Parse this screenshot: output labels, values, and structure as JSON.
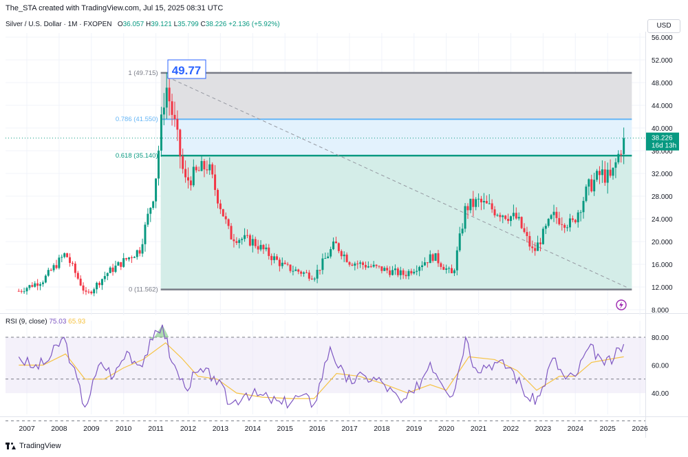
{
  "header": {
    "credit": "The_STA created with TradingView.com, Jul 15, 2025 08:31 UTC"
  },
  "symbol_bar": {
    "title": "Silver / U.S. Dollar · 1M · FXOPEN",
    "o_label": "O",
    "o_value": "36.057",
    "h_label": "H",
    "h_value": "39.121",
    "l_label": "L",
    "l_value": "35.799",
    "c_label": "C",
    "c_value": "38.226",
    "change": "+2.136 (+5.92%)"
  },
  "currency_button": "USD",
  "rsi_legend": {
    "name": "RSI (9, close)",
    "rsi_value": "75.03",
    "ma_value": "65.93"
  },
  "footer": {
    "brand": "TradingView"
  },
  "colors": {
    "up": "#089981",
    "down": "#f23645",
    "fib_top": "#e0e0e3",
    "fib_mid": "#e3f2fd",
    "fib_bottom": "#d4ede8",
    "rsi_line": "#7e57c2",
    "rsi_ma": "#f6c343",
    "line_0618": "#089981",
    "line_0786": "#64b5f6"
  },
  "chart_data": [
    {
      "type": "candlestick",
      "x_unit": "year",
      "x_ticks": [
        "2007",
        "2008",
        "2009",
        "2010",
        "2011",
        "2012",
        "2013",
        "2014",
        "2015",
        "2016",
        "2017",
        "2018",
        "2019",
        "2020",
        "2021",
        "2022",
        "2023",
        "2024",
        "2025",
        "2026"
      ],
      "y_ticks": [
        "8.000",
        "12.000",
        "16.000",
        "20.000",
        "24.000",
        "28.000",
        "32.000",
        "36.000",
        "40.000",
        "44.000",
        "48.000",
        "52.000",
        "56.000"
      ],
      "ylim": [
        8,
        57
      ],
      "scale": "linear",
      "grid": true,
      "last_price": {
        "value": "38.226",
        "countdown": "16d 13h"
      },
      "high_marker": "49.77",
      "fibonacci": [
        {
          "label": "1 (49.715)",
          "value": 49.715
        },
        {
          "label": "0.786 (41.550)",
          "value": 41.55
        },
        {
          "label": "0.618 (35.140)",
          "value": 35.14
        },
        {
          "label": "0 (11.562)",
          "value": 11.562
        }
      ],
      "fib_x_range": [
        2011.15,
        2025.75
      ],
      "trend_line": {
        "from": [
          2011.35,
          49.0
        ],
        "to": [
          2025.65,
          11.8
        ]
      },
      "key_points": [
        {
          "x": 2006.75,
          "y": 11.3
        },
        {
          "x": 2007.5,
          "y": 13.2
        },
        {
          "x": 2008.2,
          "y": 17.9
        },
        {
          "x": 2008.85,
          "y": 10.5
        },
        {
          "x": 2009.5,
          "y": 14.5
        },
        {
          "x": 2010.5,
          "y": 18.6
        },
        {
          "x": 2010.95,
          "y": 29.0
        },
        {
          "x": 2011.3,
          "y": 48.0
        },
        {
          "x": 2011.6,
          "y": 40.0
        },
        {
          "x": 2011.9,
          "y": 30.5
        },
        {
          "x": 2012.6,
          "y": 33.5
        },
        {
          "x": 2013.3,
          "y": 21.0
        },
        {
          "x": 2014.0,
          "y": 20.0
        },
        {
          "x": 2015.0,
          "y": 15.5
        },
        {
          "x": 2015.9,
          "y": 13.9
        },
        {
          "x": 2016.55,
          "y": 19.6
        },
        {
          "x": 2017.0,
          "y": 16.5
        },
        {
          "x": 2018.7,
          "y": 14.2
        },
        {
          "x": 2019.6,
          "y": 17.5
        },
        {
          "x": 2020.2,
          "y": 14.0
        },
        {
          "x": 2020.6,
          "y": 26.0
        },
        {
          "x": 2021.0,
          "y": 27.0
        },
        {
          "x": 2021.5,
          "y": 25.5
        },
        {
          "x": 2022.2,
          "y": 24.0
        },
        {
          "x": 2022.7,
          "y": 18.0
        },
        {
          "x": 2023.3,
          "y": 24.5
        },
        {
          "x": 2023.9,
          "y": 23.0
        },
        {
          "x": 2024.4,
          "y": 29.5
        },
        {
          "x": 2024.8,
          "y": 32.0
        },
        {
          "x": 2025.1,
          "y": 31.0
        },
        {
          "x": 2025.5,
          "y": 38.2
        }
      ]
    },
    {
      "type": "line",
      "title": "RSI (9, close)",
      "y_ticks": [
        "40.00",
        "60.00",
        "80.00"
      ],
      "ylim": [
        28,
        92
      ],
      "bands": [
        30,
        50,
        70
      ],
      "series": [
        {
          "name": "RSI",
          "points": [
            {
              "x": 2006.75,
              "y": 66
            },
            {
              "x": 2007.2,
              "y": 58
            },
            {
              "x": 2007.6,
              "y": 62
            },
            {
              "x": 2008.15,
              "y": 80
            },
            {
              "x": 2008.4,
              "y": 60
            },
            {
              "x": 2008.8,
              "y": 30
            },
            {
              "x": 2009.3,
              "y": 62
            },
            {
              "x": 2009.7,
              "y": 52
            },
            {
              "x": 2010.1,
              "y": 70
            },
            {
              "x": 2010.5,
              "y": 60
            },
            {
              "x": 2010.9,
              "y": 78
            },
            {
              "x": 2011.2,
              "y": 89
            },
            {
              "x": 2011.5,
              "y": 62
            },
            {
              "x": 2011.9,
              "y": 44
            },
            {
              "x": 2012.3,
              "y": 55
            },
            {
              "x": 2012.8,
              "y": 52
            },
            {
              "x": 2013.3,
              "y": 32
            },
            {
              "x": 2013.8,
              "y": 40
            },
            {
              "x": 2014.5,
              "y": 36
            },
            {
              "x": 2014.9,
              "y": 32
            },
            {
              "x": 2015.5,
              "y": 38
            },
            {
              "x": 2015.9,
              "y": 32
            },
            {
              "x": 2016.4,
              "y": 73
            },
            {
              "x": 2016.9,
              "y": 48
            },
            {
              "x": 2017.5,
              "y": 52
            },
            {
              "x": 2018.0,
              "y": 48
            },
            {
              "x": 2018.6,
              "y": 33
            },
            {
              "x": 2019.0,
              "y": 40
            },
            {
              "x": 2019.5,
              "y": 62
            },
            {
              "x": 2020.2,
              "y": 38
            },
            {
              "x": 2020.6,
              "y": 80
            },
            {
              "x": 2020.9,
              "y": 58
            },
            {
              "x": 2021.5,
              "y": 62
            },
            {
              "x": 2022.0,
              "y": 58
            },
            {
              "x": 2022.6,
              "y": 34
            },
            {
              "x": 2022.9,
              "y": 38
            },
            {
              "x": 2023.3,
              "y": 65
            },
            {
              "x": 2023.7,
              "y": 50
            },
            {
              "x": 2024.0,
              "y": 52
            },
            {
              "x": 2024.4,
              "y": 72
            },
            {
              "x": 2024.7,
              "y": 68
            },
            {
              "x": 2024.9,
              "y": 60
            },
            {
              "x": 2025.2,
              "y": 65
            },
            {
              "x": 2025.5,
              "y": 75
            }
          ]
        },
        {
          "name": "MA",
          "points": [
            {
              "x": 2006.75,
              "y": 60
            },
            {
              "x": 2007.5,
              "y": 60
            },
            {
              "x": 2008.2,
              "y": 68
            },
            {
              "x": 2008.8,
              "y": 50
            },
            {
              "x": 2009.4,
              "y": 50
            },
            {
              "x": 2010.0,
              "y": 58
            },
            {
              "x": 2010.6,
              "y": 64
            },
            {
              "x": 2011.3,
              "y": 76
            },
            {
              "x": 2011.8,
              "y": 65
            },
            {
              "x": 2012.3,
              "y": 52
            },
            {
              "x": 2012.9,
              "y": 50
            },
            {
              "x": 2013.5,
              "y": 40
            },
            {
              "x": 2014.3,
              "y": 37
            },
            {
              "x": 2015.2,
              "y": 36
            },
            {
              "x": 2015.9,
              "y": 36
            },
            {
              "x": 2016.6,
              "y": 54
            },
            {
              "x": 2017.3,
              "y": 52
            },
            {
              "x": 2018.0,
              "y": 47
            },
            {
              "x": 2018.8,
              "y": 40
            },
            {
              "x": 2019.5,
              "y": 46
            },
            {
              "x": 2020.0,
              "y": 42
            },
            {
              "x": 2020.7,
              "y": 66
            },
            {
              "x": 2021.5,
              "y": 64
            },
            {
              "x": 2022.2,
              "y": 56
            },
            {
              "x": 2022.8,
              "y": 42
            },
            {
              "x": 2023.5,
              "y": 52
            },
            {
              "x": 2024.0,
              "y": 52
            },
            {
              "x": 2024.5,
              "y": 62
            },
            {
              "x": 2025.0,
              "y": 64
            },
            {
              "x": 2025.5,
              "y": 66
            }
          ]
        }
      ]
    }
  ]
}
